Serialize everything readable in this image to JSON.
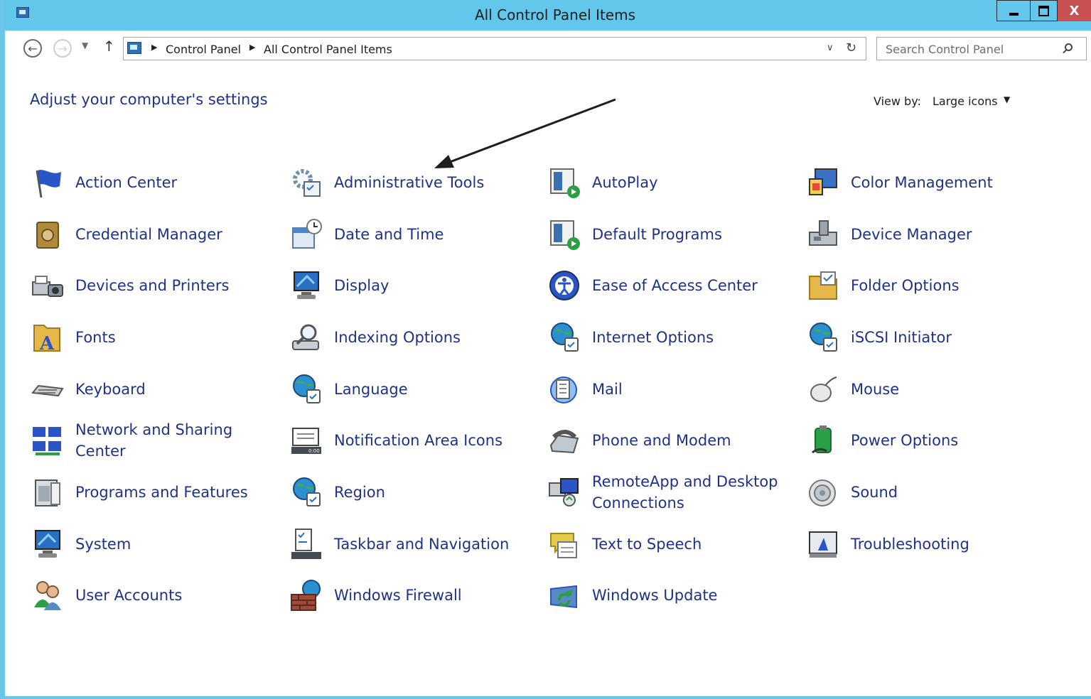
{
  "window": {
    "title": "All Control Panel Items",
    "close_label": "X"
  },
  "nav": {
    "back_glyph": "←",
    "forward_glyph": "→",
    "up_glyph": "↑",
    "breadcrumbs": [
      "Control Panel",
      "All Control Panel Items"
    ],
    "search_placeholder": "Search Control Panel"
  },
  "page": {
    "heading": "Adjust your computer's settings",
    "view_by_label": "View by:",
    "view_by_value": "Large icons"
  },
  "items": [
    {
      "label": "Action Center",
      "icon": "flag-icon",
      "color": "#2b54c4"
    },
    {
      "label": "Administrative Tools",
      "icon": "gears-icon",
      "color": "#6f8fb0"
    },
    {
      "label": "AutoPlay",
      "icon": "autoplay-icon",
      "color": "#2aa045"
    },
    {
      "label": "Color Management",
      "icon": "color-management-icon",
      "color": "#3a72c8"
    },
    {
      "label": "Credential Manager",
      "icon": "vault-icon",
      "color": "#b08a3a"
    },
    {
      "label": "Date and Time",
      "icon": "calendar-clock-icon",
      "color": "#4a86d0"
    },
    {
      "label": "Default Programs",
      "icon": "default-programs-icon",
      "color": "#2aa045"
    },
    {
      "label": "Device Manager",
      "icon": "device-manager-icon",
      "color": "#7a8a9a"
    },
    {
      "label": "Devices and Printers",
      "icon": "printer-camera-icon",
      "color": "#7a8a9a"
    },
    {
      "label": "Display",
      "icon": "monitor-icon",
      "color": "#2b6fc4"
    },
    {
      "label": "Ease of Access Center",
      "icon": "ease-of-access-icon",
      "color": "#2b54c4"
    },
    {
      "label": "Folder Options",
      "icon": "folder-options-icon",
      "color": "#e6b84a"
    },
    {
      "label": "Fonts",
      "icon": "fonts-folder-icon",
      "color": "#e6b84a"
    },
    {
      "label": "Indexing Options",
      "icon": "magnifier-drive-icon",
      "color": "#8a96a4"
    },
    {
      "label": "Internet Options",
      "icon": "globe-checklist-icon",
      "color": "#2b8fd0"
    },
    {
      "label": "iSCSI Initiator",
      "icon": "globe-shield-icon",
      "color": "#2b8fd0"
    },
    {
      "label": "Keyboard",
      "icon": "keyboard-icon",
      "color": "#8a8a8a"
    },
    {
      "label": "Language",
      "icon": "globe-language-icon",
      "color": "#2b8fd0"
    },
    {
      "label": "Mail",
      "icon": "mail-icon",
      "color": "#2b6fc4"
    },
    {
      "label": "Mouse",
      "icon": "mouse-icon",
      "color": "#9aa0a8"
    },
    {
      "label": "Network and Sharing\nCenter",
      "icon": "network-icon",
      "color": "#2b54c4"
    },
    {
      "label": "Notification Area Icons",
      "icon": "notification-area-icon",
      "color": "#444a52"
    },
    {
      "label": "Phone and Modem",
      "icon": "phone-modem-icon",
      "color": "#8a96a4"
    },
    {
      "label": "Power Options",
      "icon": "battery-icon",
      "color": "#2aa045"
    },
    {
      "label": "Programs and Features",
      "icon": "programs-features-icon",
      "color": "#7a8a9a"
    },
    {
      "label": "Region",
      "icon": "globe-clock-icon",
      "color": "#2b8fd0"
    },
    {
      "label": "RemoteApp and Desktop\nConnections",
      "icon": "remote-desktop-icon",
      "color": "#2b54c4"
    },
    {
      "label": "Sound",
      "icon": "speaker-icon",
      "color": "#9aa0a8"
    },
    {
      "label": "System",
      "icon": "system-monitor-icon",
      "color": "#2b6fc4"
    },
    {
      "label": "Taskbar and Navigation",
      "icon": "taskbar-icon",
      "color": "#444a52"
    },
    {
      "label": "Text to Speech",
      "icon": "speech-bubble-icon",
      "color": "#e6c84a"
    },
    {
      "label": "Troubleshooting",
      "icon": "troubleshooting-icon",
      "color": "#2b54c4"
    },
    {
      "label": "User Accounts",
      "icon": "users-icon",
      "color": "#5a8ac4"
    },
    {
      "label": "Windows Firewall",
      "icon": "firewall-icon",
      "color": "#a04a3a"
    },
    {
      "label": "Windows Update",
      "icon": "windows-update-icon",
      "color": "#2aa045"
    }
  ]
}
